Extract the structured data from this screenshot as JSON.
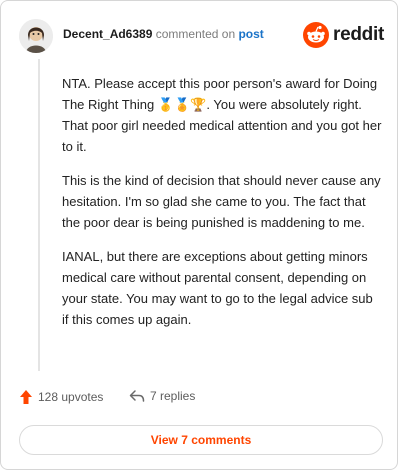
{
  "comment": {
    "username": "Decent_Ad6389",
    "action": "commented on",
    "target": "post",
    "paragraphs": [
      "NTA. Please accept this poor person's award for Doing The Right Thing 🥇🏅🏆. You were absolutely right. That poor girl needed medical attention and you got her to it.",
      "This is the kind of decision that should never cause any hesitation. I'm so glad she came to you. The fact that the poor dear is being punished is maddening to me.",
      "IANAL, but there are exceptions about getting minors medical care without parental consent, depending on your state. You may want to go to the legal advice sub if this comes up again."
    ]
  },
  "brand": {
    "name": "reddit",
    "accent": "#ff4500"
  },
  "footer": {
    "upvotes_label": "128 upvotes",
    "replies_label": "7 replies",
    "view_comments_label": "View 7 comments"
  },
  "icons": [
    "avatar",
    "reddit-logo-icon",
    "upvote-arrow-icon",
    "reply-arrow-icon"
  ]
}
